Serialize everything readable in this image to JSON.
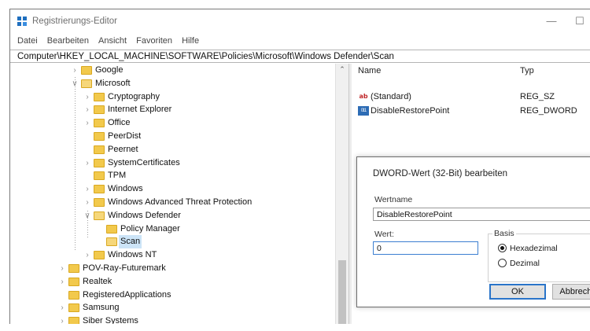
{
  "window": {
    "title": "Registrierungs-Editor"
  },
  "menu": [
    "Datei",
    "Bearbeiten",
    "Ansicht",
    "Favoriten",
    "Hilfe"
  ],
  "address": "Computer\\HKEY_LOCAL_MACHINE\\SOFTWARE\\Policies\\Microsoft\\Windows Defender\\Scan",
  "tree": [
    {
      "label": "Google",
      "level": 0,
      "chevron": "right",
      "folder": "closed"
    },
    {
      "label": "Microsoft",
      "level": 0,
      "chevron": "down",
      "folder": "open"
    },
    {
      "label": "Cryptography",
      "level": 1,
      "chevron": "right",
      "folder": "closed"
    },
    {
      "label": "Internet Explorer",
      "level": 1,
      "chevron": "right",
      "folder": "closed"
    },
    {
      "label": "Office",
      "level": 1,
      "chevron": "right",
      "folder": "closed"
    },
    {
      "label": "PeerDist",
      "level": 1,
      "chevron": "none",
      "folder": "closed"
    },
    {
      "label": "Peernet",
      "level": 1,
      "chevron": "none",
      "folder": "closed"
    },
    {
      "label": "SystemCertificates",
      "level": 1,
      "chevron": "right",
      "folder": "closed"
    },
    {
      "label": "TPM",
      "level": 1,
      "chevron": "none",
      "folder": "closed"
    },
    {
      "label": "Windows",
      "level": 1,
      "chevron": "right",
      "folder": "closed"
    },
    {
      "label": "Windows Advanced Threat Protection",
      "level": 1,
      "chevron": "right",
      "folder": "closed"
    },
    {
      "label": "Windows Defender",
      "level": 1,
      "chevron": "down",
      "folder": "open"
    },
    {
      "label": "Policy Manager",
      "level": 2,
      "chevron": "none",
      "folder": "closed"
    },
    {
      "label": "Scan",
      "level": 2,
      "chevron": "none",
      "folder": "open",
      "selected": true
    },
    {
      "label": "Windows NT",
      "level": 1,
      "chevron": "right",
      "folder": "closed"
    },
    {
      "label": "POV-Ray-Futuremark",
      "level": -1,
      "chevron": "right",
      "folder": "closed"
    },
    {
      "label": "Realtek",
      "level": -1,
      "chevron": "right",
      "folder": "closed"
    },
    {
      "label": "RegisteredApplications",
      "level": -1,
      "chevron": "none",
      "folder": "closed"
    },
    {
      "label": "Samsung",
      "level": -1,
      "chevron": "right",
      "folder": "closed"
    },
    {
      "label": "Siber Systems",
      "level": -1,
      "chevron": "right",
      "folder": "closed"
    }
  ],
  "values_pane": {
    "headers": {
      "name": "Name",
      "type": "Typ"
    },
    "rows": [
      {
        "icon": "string-value-icon",
        "glyph": "ab",
        "name": "(Standard)",
        "type": "REG_SZ"
      },
      {
        "icon": "dword-value-icon",
        "glyph": "011",
        "name": "DisableRestorePoint",
        "type": "REG_DWORD"
      }
    ]
  },
  "dialog": {
    "title": "DWORD-Wert (32-Bit) bearbeiten",
    "name_label": "Wertname",
    "name_value": "DisableRestorePoint",
    "data_label": "Wert:",
    "data_value": "0",
    "base_label": "Basis",
    "radio_hex": "Hexadezimal",
    "radio_dec": "Dezimal",
    "selected_base": "hex",
    "ok": "OK",
    "cancel": "Abbrechen"
  },
  "colors": {
    "folder": "#f2c94c",
    "selection": "#cce4f7",
    "accent": "#2a74c9"
  }
}
